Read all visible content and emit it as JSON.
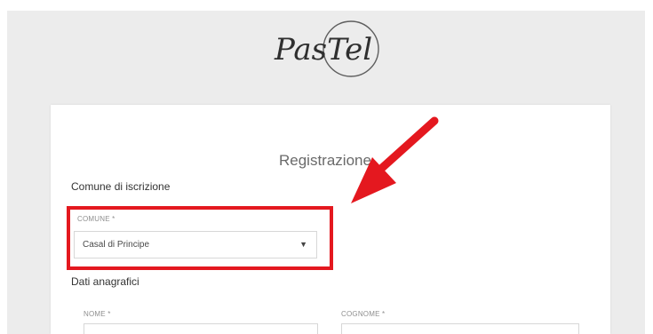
{
  "branding": {
    "logo_text": "PasTel"
  },
  "registration": {
    "title": "Registrazione",
    "section_comune": "Comune di iscrizione",
    "comune_label": "COMUNE *",
    "comune_selected": "Casal di Principe",
    "section_dati": "Dati anagrafici",
    "nome_label": "NOME *",
    "cognome_label": "COGNOME *"
  },
  "icons": {
    "dropdown": "chevron-down-icon",
    "annotation": "arrow-icon"
  },
  "colors": {
    "highlight": "#e4181f",
    "background": "#ececec",
    "card": "#ffffff"
  }
}
